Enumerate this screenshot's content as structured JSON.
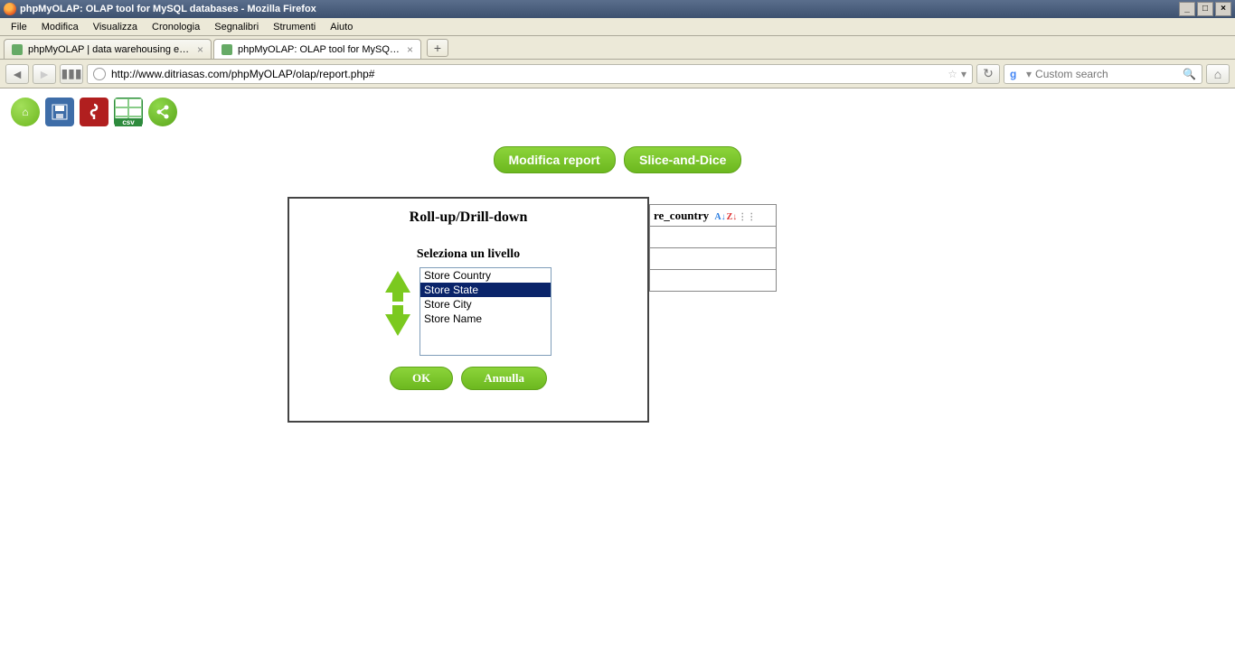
{
  "window": {
    "title": "phpMyOLAP: OLAP tool for MySQL databases - Mozilla Firefox"
  },
  "menu": {
    "items": [
      "File",
      "Modifica",
      "Visualizza",
      "Cronologia",
      "Segnalibri",
      "Strumenti",
      "Aiuto"
    ]
  },
  "tabs": {
    "items": [
      {
        "label": "phpMyOLAP | data warehousing e analisi ...",
        "active": false
      },
      {
        "label": "phpMyOLAP: OLAP tool for MySQL datab...",
        "active": true
      }
    ]
  },
  "url": "http://www.ditriasas.com/phpMyOLAP/olap/report.php#",
  "search_placeholder": "Custom search",
  "toolbar_icons": {
    "home": "⌂",
    "save": "💾",
    "pdf": "⎘",
    "excel": "X",
    "share": "<"
  },
  "actions": {
    "modify": "Modifica report",
    "slice": "Slice-and-Dice"
  },
  "dialog": {
    "title": "Roll-up/Drill-down",
    "subtitle": "Seleziona un livello",
    "levels": [
      "Store Country",
      "Store State",
      "Store City",
      "Store Name"
    ],
    "selected": "Store State",
    "ok": "OK",
    "cancel": "Annulla"
  },
  "bg_table": {
    "header_fragment": "re_country"
  }
}
